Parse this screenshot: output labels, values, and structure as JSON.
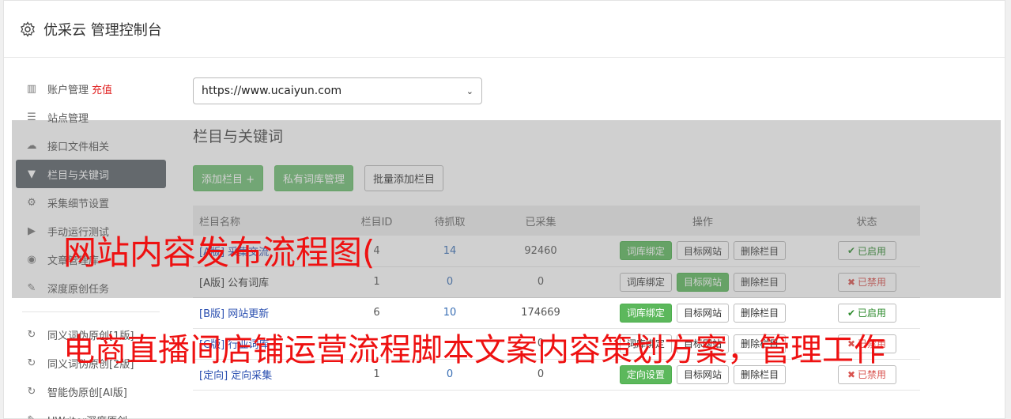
{
  "app": {
    "title": "优采云 管理控制台"
  },
  "sidebar": {
    "items": [
      {
        "icon": "bar-chart-icon",
        "label": "账户管理",
        "extra": "充值"
      },
      {
        "icon": "server-icon",
        "label": "站点管理"
      },
      {
        "icon": "cloud-upload-icon",
        "label": "接口文件相关"
      },
      {
        "icon": "filter-icon",
        "label": "栏目与关键词"
      },
      {
        "icon": "cogs-icon",
        "label": "采集细节设置"
      },
      {
        "icon": "play-icon",
        "label": "手动运行测试"
      },
      {
        "icon": "database-icon",
        "label": "文章管理库"
      },
      {
        "icon": "edit-icon",
        "label": "深度原创任务"
      }
    ],
    "items2": [
      {
        "icon": "refresh-icon",
        "label": "同义词伪原创[1版]"
      },
      {
        "icon": "refresh-icon",
        "label": "同义词伪原创[2版]"
      },
      {
        "icon": "refresh-icon",
        "label": "智能伪原创[AI版]"
      },
      {
        "icon": "edit-icon",
        "label": "UWriter深度原创"
      }
    ]
  },
  "main": {
    "site_select": "https://www.ucaiyun.com",
    "section_title": "栏目与关键词",
    "buttons": {
      "add": "添加栏目 +",
      "private_lib": "私有词库管理",
      "batch_add": "批量添加栏目"
    },
    "table": {
      "headers": [
        "栏目名称",
        "栏目ID",
        "待抓取",
        "已采集",
        "操作",
        "状态"
      ],
      "rows": [
        {
          "name": "[A版] 采集交流",
          "id": "4",
          "pending": "14",
          "collected": "92460",
          "b1": "词库绑定",
          "b2": "目标网站",
          "b3": "删除栏目",
          "status": "已启用"
        },
        {
          "name": "[A版] 公有词库",
          "id": "1",
          "pending": "0",
          "collected": "0",
          "b1": "词库绑定",
          "b2": "目标网站",
          "b3": "删除栏目",
          "status": "已禁用"
        },
        {
          "name": "[B版] 网站更新",
          "id": "6",
          "pending": "10",
          "collected": "174669",
          "b1": "词库绑定",
          "b2": "目标网站",
          "b3": "删除栏目",
          "status": "已启用"
        },
        {
          "name": "[C版] 行业词库",
          "id": "",
          "pending": "",
          "collected": "0",
          "b1": "词库绑定",
          "b2": "目标网站",
          "b3": "删除栏目",
          "status": "已禁用"
        },
        {
          "name": "[定向] 定向采集",
          "id": "1",
          "pending": "0",
          "collected": "0",
          "b1": "定向设置",
          "b2": "目标网站",
          "b3": "删除栏目",
          "status": "已禁用"
        }
      ]
    }
  },
  "watermark": {
    "line1": "网站内容发布流程图(",
    "line2": "电商直播间店铺运营流程脚本文案内容策划方案，管理工作"
  },
  "colors": {
    "green": "#5cb85c",
    "active_bg": "#5a6268",
    "red": "#ee1111"
  }
}
